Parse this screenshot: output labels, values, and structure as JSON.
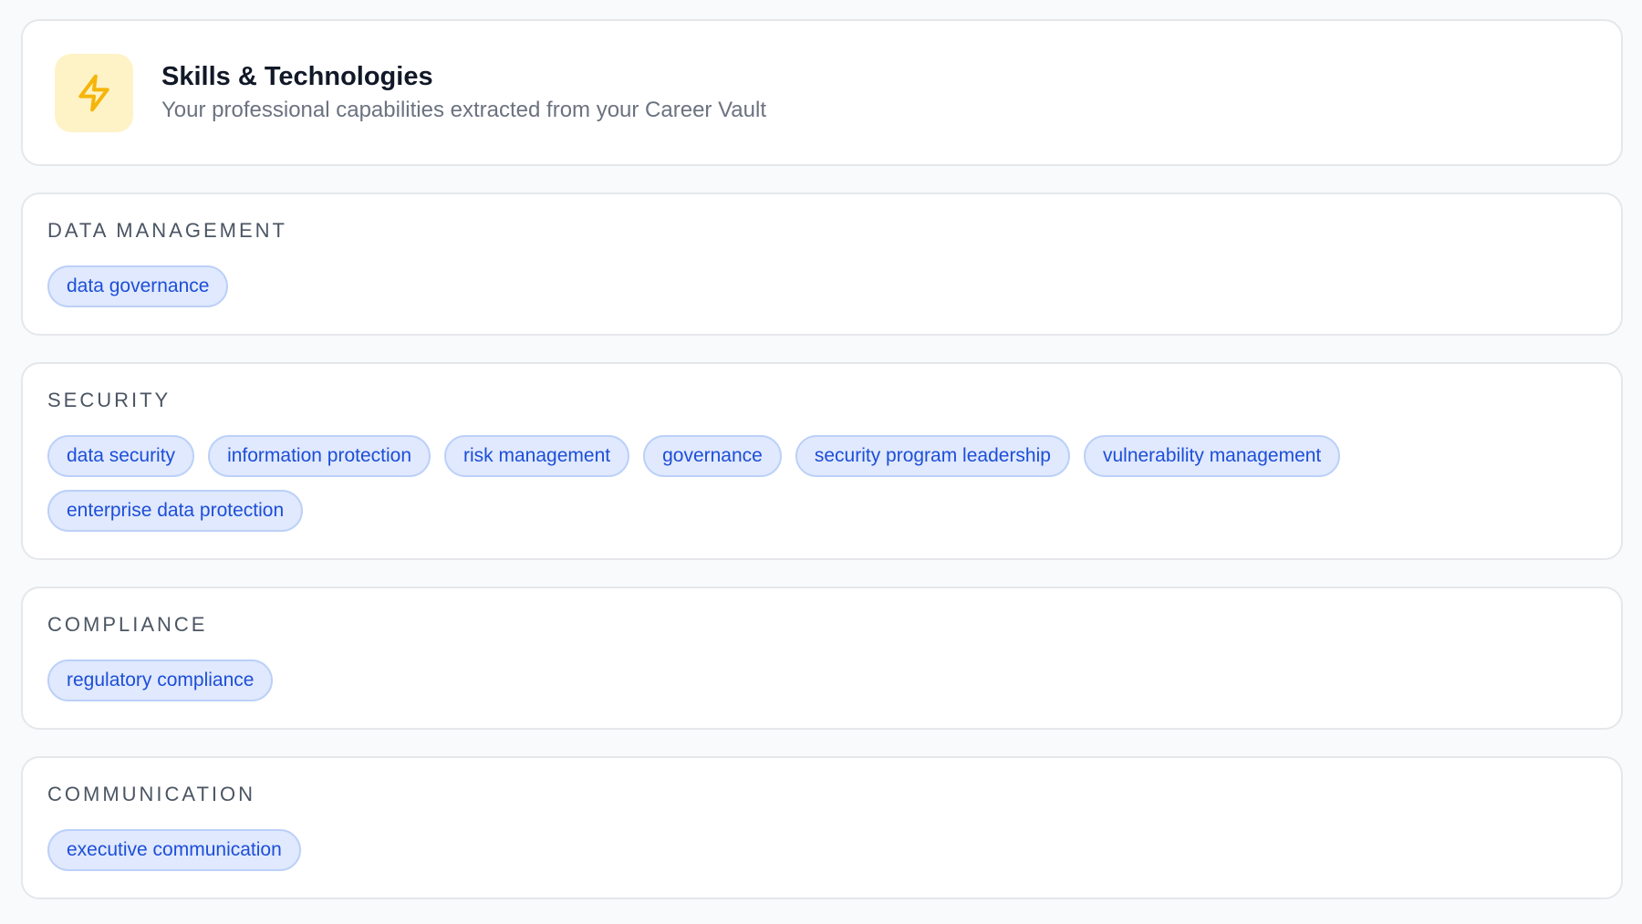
{
  "header": {
    "icon": "lightning-bolt-icon",
    "title": "Skills & Technologies",
    "subtitle": "Your professional capabilities extracted from your Career Vault"
  },
  "colors": {
    "accent": "#fbbf24",
    "chip_text": "#1d4ed8",
    "chip_bg": "#e0e9fd"
  },
  "sections": [
    {
      "title": "DATA MANAGEMENT",
      "skills": [
        "data governance"
      ]
    },
    {
      "title": "SECURITY",
      "skills": [
        "data security",
        "information protection",
        "risk management",
        "governance",
        "security program leadership",
        "vulnerability management",
        "enterprise data protection"
      ]
    },
    {
      "title": "COMPLIANCE",
      "skills": [
        "regulatory compliance"
      ]
    },
    {
      "title": "COMMUNICATION",
      "skills": [
        "executive communication"
      ]
    }
  ]
}
